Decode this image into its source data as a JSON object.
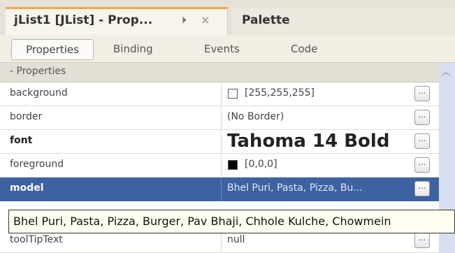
{
  "window": {
    "active_tab_title": "jList1 [JList] - Prop...",
    "palette_tab_title": "Palette"
  },
  "subtabs": [
    "Properties",
    "Binding",
    "Events",
    "Code"
  ],
  "section": {
    "title": "- Properties"
  },
  "properties": [
    {
      "name": "background",
      "value": "[255,255,255]",
      "swatch_color": "#ffffff"
    },
    {
      "name": "border",
      "value": "(No Border)"
    },
    {
      "name": "font",
      "value": "Tahoma 14 Bold"
    },
    {
      "name": "foreground",
      "value": "[0,0,0]",
      "swatch_color": "#000000"
    },
    {
      "name": "model",
      "value": "Bhel Puri, Pasta, Pizza, Bu...",
      "selected": true
    },
    {
      "name": "toolTipText",
      "value": "null"
    }
  ],
  "more_button_label": "...",
  "tooltip": {
    "text": "Bhel Puri, Pasta, Pizza, Burger, Pav Bhaji, Chhole Kulche, Chowmein"
  },
  "colors": {
    "selection": "#3d62a2",
    "active_tab_accent": "#f2a84a",
    "tooltip_bg": "#fffff0"
  }
}
